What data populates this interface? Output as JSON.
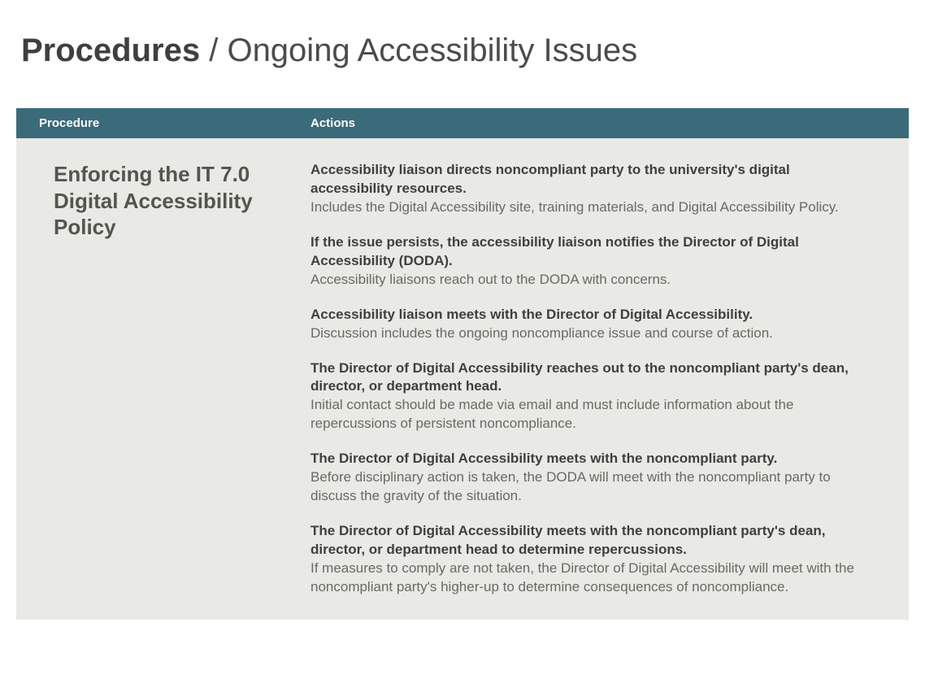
{
  "header": {
    "title_bold": "Procedures",
    "title_rest": " / Ongoing Accessibility Issues"
  },
  "table": {
    "headers": {
      "procedure": "Procedure",
      "actions": "Actions"
    },
    "procedure_title": "Enforcing the IT 7.0 Digital Accessibility Policy",
    "actions": [
      {
        "title": "Accessibility liaison directs noncompliant party to the university's digital accessibility resources.",
        "desc": "Includes the Digital Accessibility site, training materials, and Digital Accessibility Policy."
      },
      {
        "title": "If the issue persists, the accessibility liaison notifies the Director of Digital Accessibility (DODA).",
        "desc": "Accessibility liaisons reach out to the DODA with concerns."
      },
      {
        "title": "Accessibility liaison meets with the Director of Digital Accessibility.",
        "desc": "Discussion includes the ongoing noncompliance issue and course of action."
      },
      {
        "title": "The Director of Digital Accessibility reaches out to the noncompliant party's dean, director, or department head.",
        "desc": "Initial contact should be made via email and must include information about the repercussions of persistent noncompliance."
      },
      {
        "title": "The Director of Digital Accessibility meets with the noncompliant party.",
        "desc": "Before disciplinary action is taken, the DODA will meet with the noncompliant party to discuss the gravity of the situation."
      },
      {
        "title": "The Director of Digital Accessibility meets with the noncompliant party's dean, director, or department head to determine repercussions.",
        "desc": "If measures to comply are not taken, the Director of Digital Accessibility will meet with the noncompliant party's higher-up to determine consequences of noncompliance."
      }
    ]
  }
}
